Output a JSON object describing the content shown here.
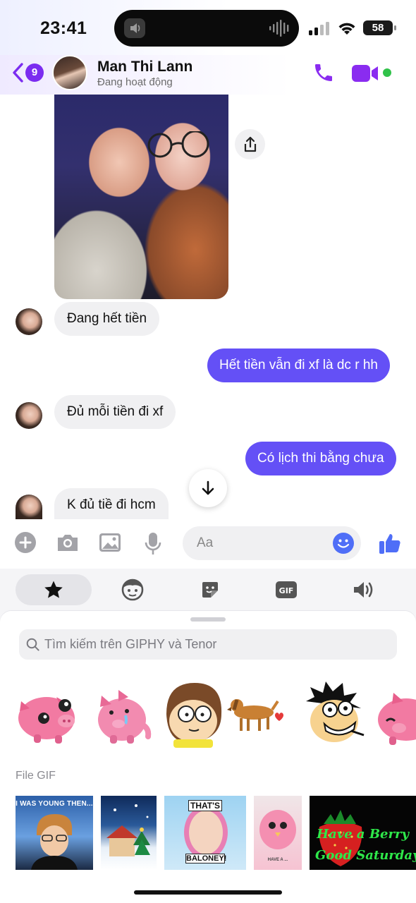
{
  "status_bar": {
    "time": "23:41",
    "battery": "58"
  },
  "header": {
    "unread_count": "9",
    "contact_name": "Man Thi Lann",
    "presence": "Đang hoạt động",
    "icons": {
      "back": "chevron-left-icon",
      "call": "phone-icon",
      "video": "video-camera-icon"
    }
  },
  "messages": [
    {
      "from": "them",
      "text": "Đang hết tiền"
    },
    {
      "from": "me",
      "text": "Hết tiền vẫn đi xf là dc r hh"
    },
    {
      "from": "them",
      "text": "Đủ mỗi tiền đi xf"
    },
    {
      "from": "me",
      "text": "Có lịch thi bằng chưa"
    },
    {
      "from": "them",
      "text": "K đủ tiề đi hcm"
    }
  ],
  "composer": {
    "placeholder": "Aa"
  },
  "tray": {
    "tabs": [
      "star-icon",
      "avatar-face-icon",
      "sticker-icon",
      "gif-icon",
      "sound-icon"
    ],
    "search_placeholder": "Tìm kiếm trên GIPHY và Tenor",
    "gif_section_label": "File GIF",
    "gifs": [
      {
        "caption": "I WAS YOUNG THEN..."
      },
      {
        "caption": ""
      },
      {
        "caption_top": "THAT'S",
        "caption_bottom": "BALONEY!"
      },
      {
        "caption": "HAVE A ..."
      },
      {
        "caption_line1": "Have a Berry",
        "caption_line2": "Good Saturday!"
      }
    ]
  },
  "colors": {
    "accent": "#7b2cf0",
    "outgoing_bubble": "#6450f6",
    "incoming_bubble": "#f0f0f2",
    "online": "#31c24a"
  }
}
